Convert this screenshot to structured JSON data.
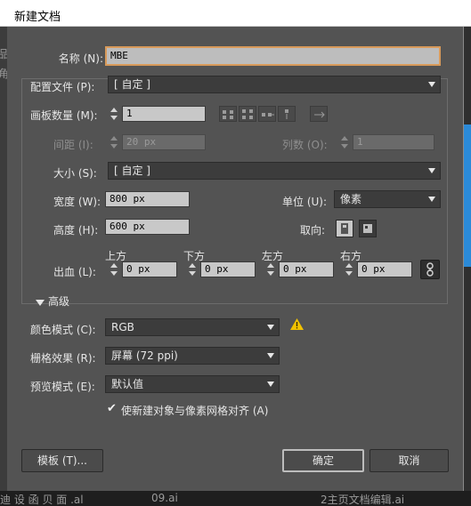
{
  "window": {
    "title": "新建文档"
  },
  "background": {
    "left_fragments": [
      "品",
      "角"
    ],
    "bottom_fragments": [
      "迪 设 函 贝 面 .al",
      "09.ai",
      "2主页文档编辑.ai"
    ]
  },
  "name": {
    "label": "名称 (N):",
    "value": "MBE"
  },
  "profile": {
    "label": "配置文件 (P):",
    "value": "[ 自定 ]"
  },
  "artboards": {
    "label": "画板数量 (M):",
    "value": "1"
  },
  "spacing": {
    "label": "间距 (I):",
    "value": "20 px"
  },
  "columns": {
    "label": "列数 (O):",
    "value": "1"
  },
  "size": {
    "label": "大小 (S):",
    "value": "[ 自定 ]"
  },
  "width": {
    "label": "宽度 (W):",
    "value": "800 px"
  },
  "units": {
    "label": "单位 (U):",
    "value": "像素"
  },
  "height": {
    "label": "高度 (H):",
    "value": "600 px"
  },
  "orientation": {
    "label": "取向:"
  },
  "bleed": {
    "label": "出血 (L):",
    "top": {
      "label": "上方",
      "value": "0 px"
    },
    "bottom": {
      "label": "下方",
      "value": "0 px"
    },
    "left": {
      "label": "左方",
      "value": "0 px"
    },
    "right": {
      "label": "右方",
      "value": "0 px"
    }
  },
  "advanced": {
    "label": "高级"
  },
  "color_mode": {
    "label": "颜色模式 (C):",
    "value": "RGB"
  },
  "raster_effects": {
    "label": "栅格效果 (R):",
    "value": "屏幕 (72 ppi)"
  },
  "preview_mode": {
    "label": "预览模式 (E):",
    "value": "默认值"
  },
  "align_pixel": {
    "label": "使新建对象与像素网格对齐 (A)",
    "checked": true
  },
  "buttons": {
    "templates": "模板 (T)...",
    "ok": "确定",
    "cancel": "取消"
  },
  "colors": {
    "dialog_bg": "#535353",
    "focus_border": "#d89a5a",
    "warning": "#f2c200",
    "accent_blue": "#2b8ad8"
  }
}
